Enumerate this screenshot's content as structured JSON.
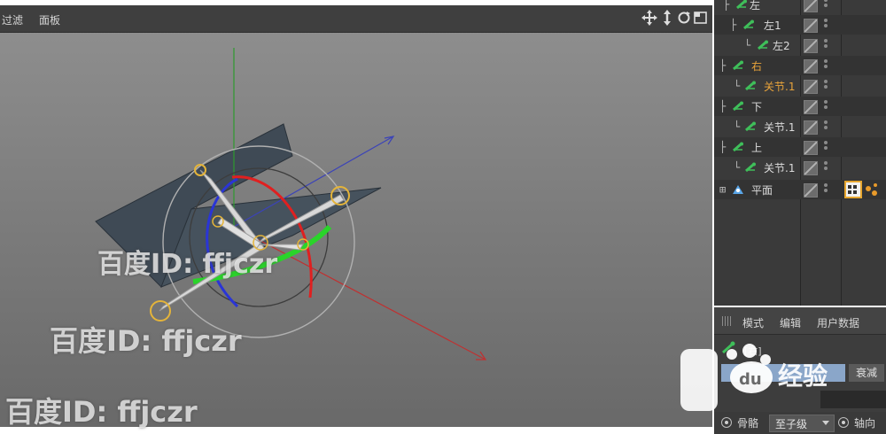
{
  "viewport": {
    "menu": {
      "filter": "过滤",
      "panel": "面板"
    },
    "nav_icons": [
      "move-icon",
      "drag-icon",
      "rotate-icon",
      "maximize-icon"
    ]
  },
  "object_manager": {
    "rows": [
      {
        "name": "左",
        "highlight": false
      },
      {
        "name": "左1",
        "highlight": false
      },
      {
        "name": "左2",
        "highlight": false
      },
      {
        "name": "右",
        "highlight": true
      },
      {
        "name": "关节.1",
        "highlight": true
      },
      {
        "name": "下",
        "highlight": false
      },
      {
        "name": "关节.1",
        "highlight": false
      },
      {
        "name": "上",
        "highlight": false
      },
      {
        "name": "关节.1",
        "highlight": false
      },
      {
        "name": "平面",
        "highlight": false
      }
    ],
    "colors": {
      "highlight": "#e8a33a",
      "normal": "#dcdcdc"
    }
  },
  "attributes": {
    "tabs": {
      "mode": "模式",
      "edit": "编辑",
      "user_data": "用户数据"
    },
    "title": "[右]",
    "falloff_button": "衰减",
    "bone_label": "骨骼",
    "mode_option": "至子级",
    "axis_label": "轴向"
  },
  "watermarks": {
    "line1": "百度ID: ffjczr",
    "line2": "百度ID: ffjczr",
    "line3": "百度ID: ffjczr",
    "logo_text": "经验"
  }
}
